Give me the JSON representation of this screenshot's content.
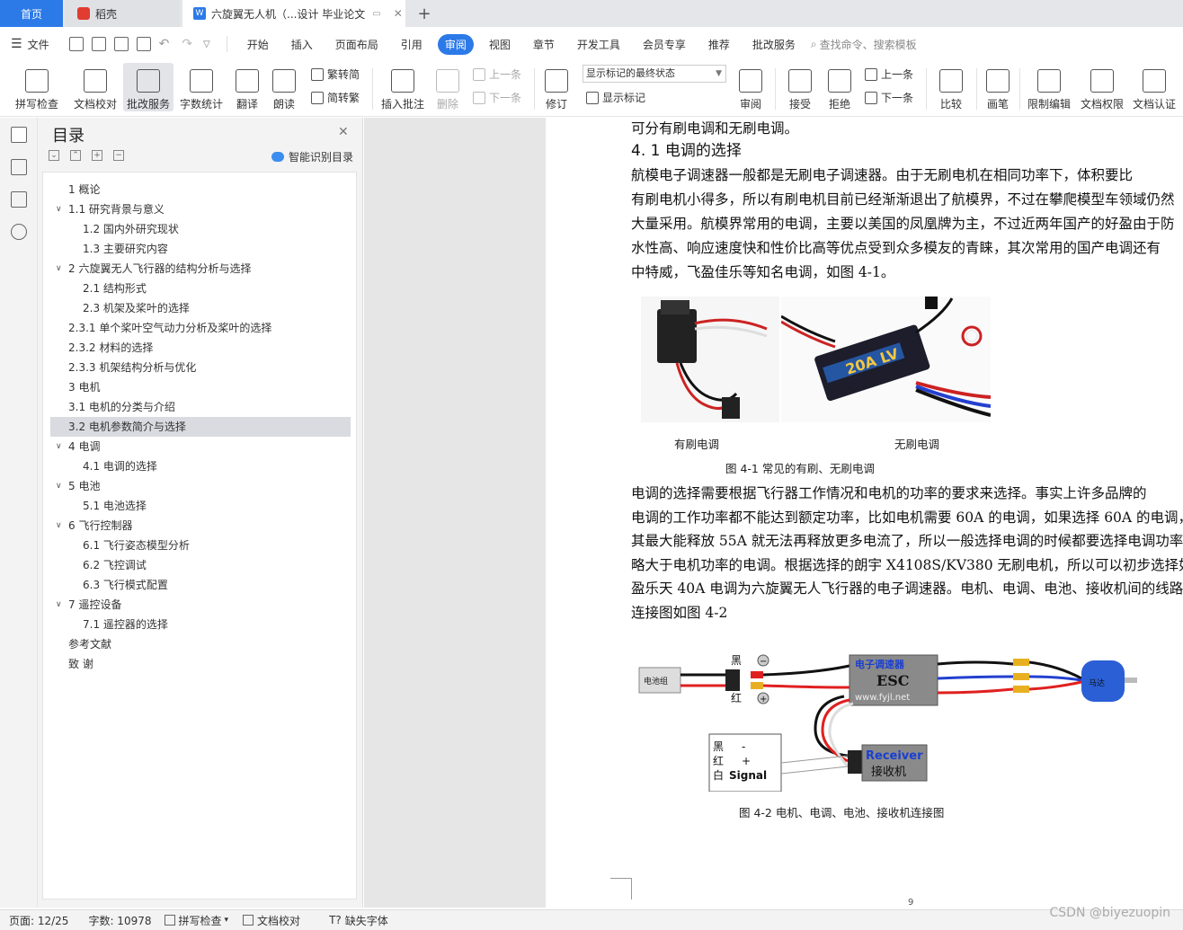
{
  "tabs": {
    "home": "首页",
    "daoke": "稻壳",
    "doc": "六旋翼无人机（...设计 毕业论文",
    "new_tab": "+"
  },
  "menu": {
    "file": "文件",
    "items": [
      "开始",
      "插入",
      "页面布局",
      "引用",
      "审阅",
      "视图",
      "章节",
      "开发工具",
      "会员专享",
      "推荐",
      "批改服务"
    ],
    "active": "审阅",
    "search": "查找命令、搜索模板"
  },
  "ribbon": {
    "spellcheck": "拼写检查",
    "doccheck": "文档校对",
    "review_service": "批改服务",
    "wordcount": "字数统计",
    "translate": "翻译",
    "read": "朗读",
    "trad": "繁转简",
    "simp": "简转繁",
    "insert_comment": "插入批注",
    "delete": "删除",
    "prev": "上一条",
    "next": "下一条",
    "revise": "修订",
    "mark_state": "显示标记的最终状态",
    "show_marks": "显示标记",
    "review": "审阅",
    "accept": "接受",
    "reject": "拒绝",
    "prev2": "上一条",
    "next2": "下一条",
    "compare": "比较",
    "pen": "画笔",
    "restrict": "限制编辑",
    "perm": "文档权限",
    "cert": "文档认证"
  },
  "toc": {
    "title": "目录",
    "smart": "智能识别目录",
    "items": [
      {
        "text": "1  概论",
        "indent": 1,
        "arrow": false,
        "selected": false
      },
      {
        "text": "1.1   研究背景与意义",
        "indent": 0,
        "arrow": true,
        "selected": false
      },
      {
        "text": "1.2  国内外研究现状",
        "indent": 2,
        "arrow": false,
        "selected": false
      },
      {
        "text": "1.3  主要研究内容",
        "indent": 2,
        "arrow": false,
        "selected": false
      },
      {
        "text": "2 六旋翼无人飞行器的结构分析与选择",
        "indent": 0,
        "arrow": true,
        "selected": false
      },
      {
        "text": "2.1 结构形式",
        "indent": 2,
        "arrow": false,
        "selected": false
      },
      {
        "text": "2.3 机架及桨叶的选择",
        "indent": 2,
        "arrow": false,
        "selected": false
      },
      {
        "text": "2.3.1  单个桨叶空气动力分析及桨叶的选择",
        "indent": 1,
        "arrow": false,
        "selected": false
      },
      {
        "text": "2.3.2 材料的选择",
        "indent": 1,
        "arrow": false,
        "selected": false
      },
      {
        "text": "2.3.3 机架结构分析与优化",
        "indent": 1,
        "arrow": false,
        "selected": false
      },
      {
        "text": "3 电机",
        "indent": 1,
        "arrow": false,
        "selected": false
      },
      {
        "text": "3.1 电机的分类与介绍",
        "indent": 1,
        "arrow": false,
        "selected": false
      },
      {
        "text": "3.2 电机参数简介与选择",
        "indent": 1,
        "arrow": false,
        "selected": true
      },
      {
        "text": "4 电调",
        "indent": 0,
        "arrow": true,
        "selected": false
      },
      {
        "text": "4.1 电调的选择",
        "indent": 2,
        "arrow": false,
        "selected": false
      },
      {
        "text": "5 电池",
        "indent": 0,
        "arrow": true,
        "selected": false
      },
      {
        "text": "5.1 电池选择",
        "indent": 2,
        "arrow": false,
        "selected": false
      },
      {
        "text": "6 飞行控制器",
        "indent": 0,
        "arrow": true,
        "selected": false
      },
      {
        "text": "6.1 飞行姿态模型分析",
        "indent": 2,
        "arrow": false,
        "selected": false
      },
      {
        "text": "6.2 飞控调试",
        "indent": 2,
        "arrow": false,
        "selected": false
      },
      {
        "text": "6.3 飞行模式配置",
        "indent": 2,
        "arrow": false,
        "selected": false
      },
      {
        "text": "7 遥控设备",
        "indent": 0,
        "arrow": true,
        "selected": false
      },
      {
        "text": "7.1 遥控器的选择",
        "indent": 2,
        "arrow": false,
        "selected": false
      },
      {
        "text": "参考文献",
        "indent": 1,
        "arrow": false,
        "selected": false
      },
      {
        "text": "致    谢",
        "indent": 1,
        "arrow": false,
        "selected": false
      }
    ]
  },
  "doc": {
    "top_line": "可分有刷电调和无刷电调。",
    "heading": "4. 1 电调的选择",
    "para1": [
      "        航模电子调速器一般都是无刷电子调速器。由于无刷电机在相同功率下，体积要比",
      "有刷电机小得多，所以有刷电机目前已经渐渐退出了航模界，不过在攀爬模型车领域仍然",
      "大量采用。航模界常用的电调，主要以美国的凤凰牌为主，不过近两年国产的好盈由于防",
      "水性高、响应速度快和性价比高等优点受到众多模友的青睐，其次常用的国产电调还有",
      "中特威，飞盈佳乐等知名电调，如图 4-1。"
    ],
    "label_brushed": "有刷电调",
    "label_brushless": "无刷电调",
    "fig1_caption": "图 4-1    常见的有刷、无刷电调",
    "esc_brand": "20A LV",
    "para2": [
      "       电调的选择需要根据飞行器工作情况和电机的功率的要求来选择。事实上许多品牌的",
      "电调的工作功率都不能达到额定功率，比如电机需要 60A 的电调，如果选择 60A 的电调，",
      "其最大能释放 55A 就无法再释放更多电流了，所以一般选择电调的时候都要选择电调功率",
      "略大于电机功率的电调。根据选择的朗宇  X4108S/KV380 无刷电机，所以可以初步选择如",
      "盈乐天 40A 电调为六旋翼无人飞行器的电子调速器。电机、电调、电池、接收机间的线路",
      "连接图如图 4-2"
    ],
    "fig2": {
      "battery": "电池组",
      "black": "黑",
      "red": "红",
      "minus": "−",
      "plus": "+",
      "esc_cn": "电子调速器",
      "esc_en": "ESC",
      "esc_url": "www.fyjl.net",
      "motor": "马达",
      "legend_black": "黑",
      "legend_red": "红",
      "legend_white": "白",
      "legend_minus": "-",
      "legend_plus": "+",
      "legend_signal": "Signal",
      "receiver_en": "Receiver",
      "receiver_cn": "接收机"
    },
    "fig2_caption": "图 4-2    电机、电调、电池、接收机连接图",
    "page_number": "9"
  },
  "status": {
    "page": "页面: 12/25",
    "words": "字数: 10978",
    "spell": "拼写检查",
    "proof": "文档校对",
    "font_missing": "缺失字体"
  },
  "watermark": "CSDN @biyezuopin",
  "colors": {
    "accent": "#2c7ae8",
    "toc_selected": "#d9dbe0",
    "wire_red": "#e02020",
    "wire_black": "#111111",
    "wire_blue": "#2340d0",
    "motor_blue": "#2a5fd6"
  }
}
